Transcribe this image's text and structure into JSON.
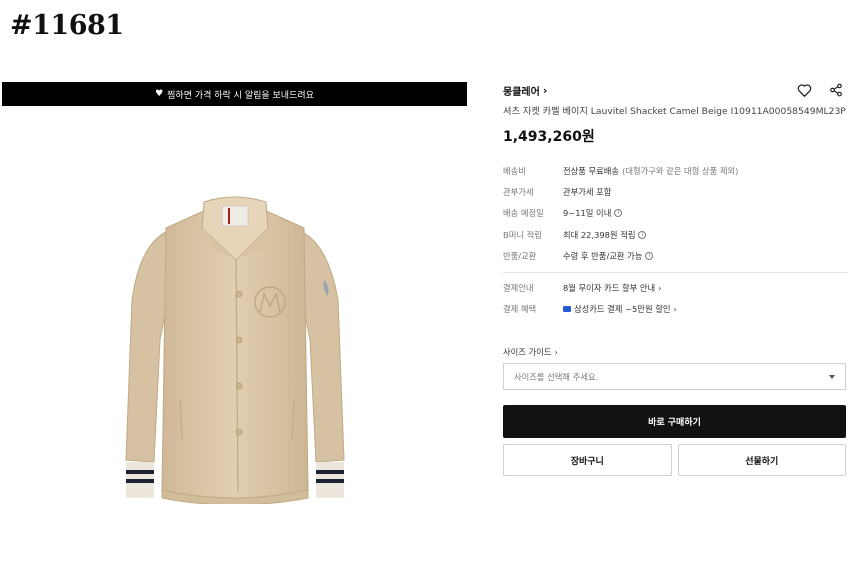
{
  "page_id": "#11681",
  "banner": {
    "text": "찜하면 가격 하락 시 알림을 보내드려요"
  },
  "product": {
    "brand": "몽클레어",
    "title": "셔츠 자켓 카멜 베이지 Lauvitel Shacket Camel Beige I10911A00058549ML23P",
    "price": "1,493,260원",
    "info": [
      {
        "key": "배송비",
        "value": "전상품 무료배송",
        "sub": "(대형가구와 같은 대형 상품 제외)"
      },
      {
        "key": "관부가세",
        "value": "관부가세 포함"
      },
      {
        "key": "배송 예정일",
        "value": "9~11일 이내"
      },
      {
        "key": "B머니 적립",
        "value": "최대 22,398원 적립"
      },
      {
        "key": "반품/교환",
        "value": "수령 후 반품/교환 가능"
      }
    ],
    "payment": [
      {
        "key": "결제안내",
        "value": "8월 무이자 카드 할부 안내"
      },
      {
        "key": "결제 혜택",
        "value": "삼성카드 결제 ~5만원 할인"
      }
    ],
    "size_guide": "사이즈 가이드",
    "size_placeholder": "사이즈를 선택해 주세요.",
    "buy_label": "바로 구매하기",
    "cart_label": "장바구니",
    "gift_label": "선물하기"
  },
  "icons": {
    "wishlist": "heart-outline-icon",
    "share": "share-icon"
  },
  "colors": {
    "banner_bg": "#000000",
    "buy_bg": "#111111",
    "jacket": "#dcc7a7"
  }
}
